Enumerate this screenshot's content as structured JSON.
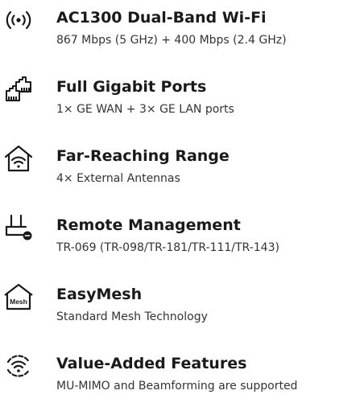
{
  "colors": {
    "text": "#1a1a1a",
    "subtext": "#333333",
    "background": "#ffffff"
  },
  "features": [
    {
      "icon": "wifi-signal-icon",
      "title": "AC1300 Dual-Band Wi-Fi",
      "description": "867 Mbps (5 GHz) + 400 Mbps (2.4 GHz)"
    },
    {
      "icon": "ethernet-ports-icon",
      "title": "Full Gigabit Ports",
      "description": "1× GE WAN + 3× GE LAN ports"
    },
    {
      "icon": "home-wifi-icon",
      "title": "Far-Reaching Range",
      "description": "4× External Antennas"
    },
    {
      "icon": "remote-management-icon",
      "title": "Remote Management",
      "description": "TR-069 (TR-098/TR-181/TR-111/TR-143)"
    },
    {
      "icon": "mesh-house-icon",
      "icon_text": "Mesh",
      "title": "EasyMesh",
      "description": "Standard Mesh Technology"
    },
    {
      "icon": "value-added-wifi-icon",
      "title": "Value-Added Features",
      "description": "MU-MIMO and Beamforming are supported"
    }
  ]
}
